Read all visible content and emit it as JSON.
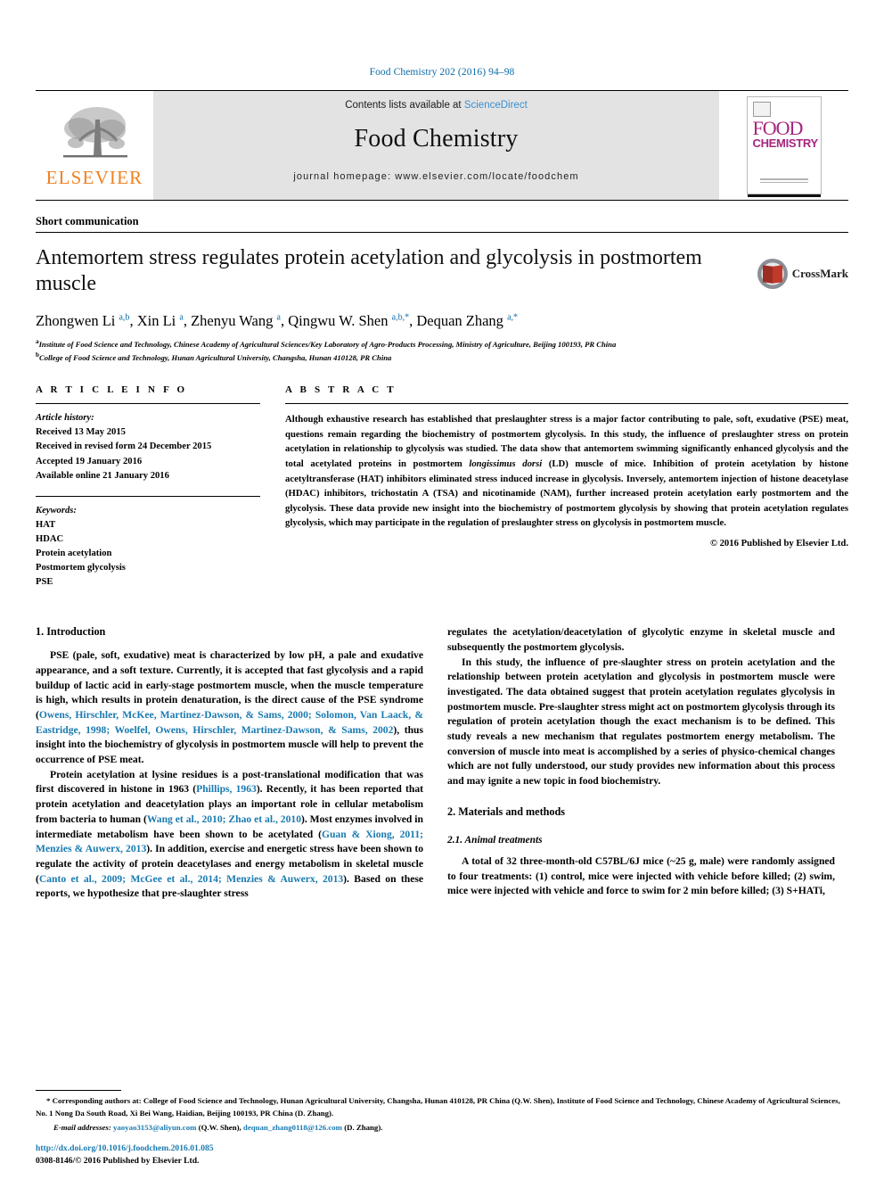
{
  "running_head": "Food Chemistry 202 (2016) 94–98",
  "masthead": {
    "contents_prefix": "Contents lists available at ",
    "sciencedirect": "ScienceDirect",
    "journal_title": "Food Chemistry",
    "homepage": "journal homepage: www.elsevier.com/locate/foodchem",
    "publisher_logo_text": "ELSEVIER",
    "cover_title_line1": "FOOD",
    "cover_title_line2": "CHEMISTRY",
    "accent_orange": "#f08122",
    "accent_magenta": "#a6257f",
    "link_blue": "#1a7ab0"
  },
  "article": {
    "type_label": "Short communication",
    "title": "Antemortem stress regulates protein acetylation and glycolysis in postmortem muscle",
    "crossmark_label": "CrossMark",
    "authors_html": "Zhongwen Li <sup>a,b</sup>, Xin Li <sup>a</sup>, Zhenyu Wang <sup>a</sup>, Qingwu W. Shen <sup>a,b,</sup><sup>*</sup>, Dequan Zhang <sup>a,</sup><sup>*</sup>",
    "affiliations": [
      "Institute of Food Science and Technology, Chinese Academy of Agricultural Sciences/Key Laboratory of Agro-Products Processing, Ministry of Agriculture, Beijing 100193, PR China",
      "College of Food Science and Technology, Hunan Agricultural University, Changsha, Hunan 410128, PR China"
    ],
    "affiliation_marks": [
      "a",
      "b"
    ]
  },
  "article_info": {
    "heading": "A R T I C L E   I N F O",
    "history_label": "Article history:",
    "history": [
      "Received 13 May 2015",
      "Received in revised form 24 December 2015",
      "Accepted 19 January 2016",
      "Available online 21 January 2016"
    ],
    "keywords_label": "Keywords:",
    "keywords": [
      "HAT",
      "HDAC",
      "Protein acetylation",
      "Postmortem glycolysis",
      "PSE"
    ]
  },
  "abstract": {
    "heading": "A B S T R A C T",
    "text": "Although exhaustive research has established that preslaughter stress is a major factor contributing to pale, soft, exudative (PSE) meat, questions remain regarding the biochemistry of postmortem glycolysis. In this study, the influence of preslaughter stress on protein acetylation in relationship to glycolysis was studied. The data show that antemortem swimming significantly enhanced glycolysis and the total acetylated proteins in postmortem longissimus dorsi (LD) muscle of mice. Inhibition of protein acetylation by histone acetyltransferase (HAT) inhibitors eliminated stress induced increase in glycolysis. Inversely, antemortem injection of histone deacetylase (HDAC) inhibitors, trichostatin A (TSA) and nicotinamide (NAM), further increased protein acetylation early postmortem and the glycolysis. These data provide new insight into the biochemistry of postmortem glycolysis by showing that protein acetylation regulates glycolysis, which may participate in the regulation of preslaughter stress on glycolysis in postmortem muscle.",
    "italic_term": "longissimus dorsi",
    "copyright": "© 2016 Published by Elsevier Ltd."
  },
  "body": {
    "section1_heading": "1. Introduction",
    "section1_p1_a": "PSE (pale, soft, exudative) meat is characterized by low pH, a pale and exudative appearance, and a soft texture. Currently, it is accepted that fast glycolysis and a rapid buildup of lactic acid in early-stage postmortem muscle, when the muscle temperature is high, which results in protein denaturation, is the direct cause of the PSE syndrome (",
    "section1_p1_cite": "Owens, Hirschler, McKee, Martinez-Dawson, & Sams, 2000; Solomon, Van Laack, & Eastridge, 1998; Woelfel, Owens, Hirschler, Martinez-Dawson, & Sams, 2002",
    "section1_p1_b": "), thus insight into the biochemistry of glycolysis in postmortem muscle will help to prevent the occurrence of PSE meat.",
    "section1_p2_a": "Protein acetylation at lysine residues is a post-translational modification that was first discovered in histone in 1963 (",
    "section1_p2_cite1": "Phillips, 1963",
    "section1_p2_b": "). Recently, it has been reported that protein acetylation and deacetylation plays an important role in cellular metabolism from bacteria to human (",
    "section1_p2_cite2": "Wang et al., 2010; Zhao et al., 2010",
    "section1_p2_c": "). Most enzymes involved in intermediate metabolism have been shown to be acetylated (",
    "section1_p2_cite3": "Guan & Xiong, 2011; Menzies & Auwerx, 2013",
    "section1_p2_d": "). In addition, exercise and energetic stress have been shown to regulate the activity of protein deacetylases and energy metabolism in skeletal muscle (",
    "section1_p2_cite4": "Canto et al., 2009; McGee et al., 2014; Menzies & Auwerx, 2013",
    "section1_p2_e": "). Based on these reports, we hypothesize that pre-slaughter stress",
    "col2_cont": "regulates the acetylation/deacetylation of glycolytic enzyme in skeletal muscle and subsequently the postmortem glycolysis.",
    "col2_p2": "In this study, the influence of pre-slaughter stress on protein acetylation and the relationship between protein acetylation and glycolysis in postmortem muscle were investigated. The data obtained suggest that protein acetylation regulates glycolysis in postmortem muscle. Pre-slaughter stress might act on postmortem glycolysis through its regulation of protein acetylation though the exact mechanism is to be defined. This study reveals a new mechanism that regulates postmortem energy metabolism. The conversion of muscle into meat is accomplished by a series of physico-chemical changes which are not fully understood, our study provides new information about this process and may ignite a new topic in food biochemistry.",
    "section2_heading": "2. Materials and methods",
    "section2_1_heading": "2.1. Animal treatments",
    "section2_1_p1": "A total of 32 three-month-old C57BL/6J mice (~25 g, male) were randomly assigned to four treatments: (1) control, mice were injected with vehicle before killed; (2) swim, mice were injected with vehicle and force to swim for 2 min before killed; (3) S+HATi,"
  },
  "footnotes": {
    "corresponding_mark": "*",
    "corresponding_text": "Corresponding authors at: College of Food Science and Technology, Hunan Agricultural University, Changsha, Hunan 410128, PR China (Q.W. Shen), Institute of Food Science and Technology, Chinese Academy of Agricultural Sciences, No. 1 Nong Da South Road, Xi Bei Wang, Haidian, Beijing 100193, PR China (D. Zhang).",
    "email_label": "E-mail addresses:",
    "email1": "yaoyao3153@aliyun.com",
    "email1_owner": "(Q.W. Shen),",
    "email2": "dequan_zhang0118@126.com",
    "email2_owner": "(D. Zhang).",
    "doi": "http://dx.doi.org/10.1016/j.foodchem.2016.01.085",
    "issn_line": "0308-8146/© 2016 Published by Elsevier Ltd."
  }
}
